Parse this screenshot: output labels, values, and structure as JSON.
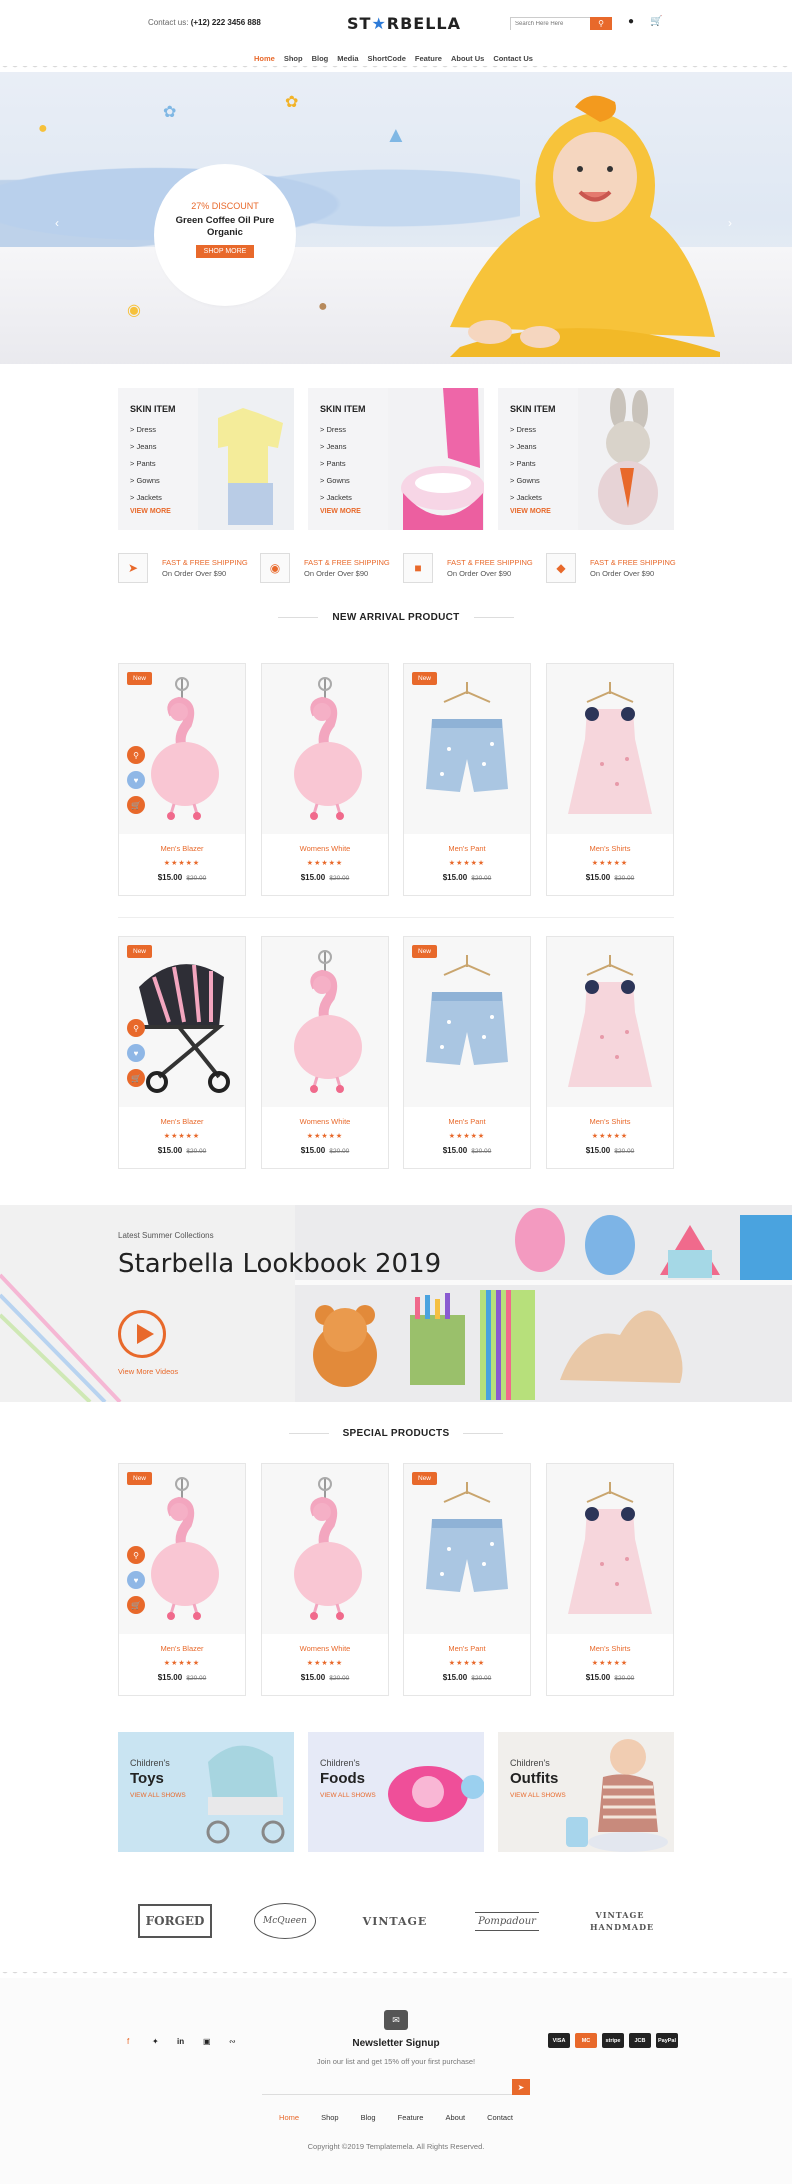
{
  "header": {
    "contact_label": "Contact us:",
    "contact_phone": "(+12) 222 3456 888",
    "logo_left": "ST",
    "logo_star": "★",
    "logo_right": "RBELLA",
    "search_placeholder": "Search Here Here",
    "nav": [
      "Home",
      "Shop",
      "Blog",
      "Media",
      "ShortCode",
      "Feature",
      "About Us",
      "Contact Us"
    ],
    "nav_active": "Home"
  },
  "hero": {
    "discount": "27% DISCOUNT",
    "title_line1": "Green Coffee Oil Pure",
    "title_line2": "Organic",
    "cta": "SHOP MORE"
  },
  "categories": [
    {
      "title": "SKIN ITEM",
      "items": [
        "> Dress",
        "> Jeans",
        "> Pants",
        "> Gowns",
        "> Jackets"
      ],
      "link": "VIEW MORE"
    },
    {
      "title": "SKIN ITEM",
      "items": [
        "> Dress",
        "> Jeans",
        "> Pants",
        "> Gowns",
        "> Jackets"
      ],
      "link": "VIEW MORE"
    },
    {
      "title": "SKIN ITEM",
      "items": [
        "> Dress",
        "> Jeans",
        "> Pants",
        "> Gowns",
        "> Jackets"
      ],
      "link": "VIEW MORE"
    }
  ],
  "shipping": [
    {
      "title": "FAST & FREE SHIPPING",
      "sub": "On Order Over $90"
    },
    {
      "title": "FAST & FREE SHIPPING",
      "sub": "On Order Over $90"
    },
    {
      "title": "FAST & FREE SHIPPING",
      "sub": "On Order Over $90"
    },
    {
      "title": "FAST & FREE SHIPPING",
      "sub": "On Order Over $90"
    }
  ],
  "new_arrival": {
    "heading": "NEW ARRIVAL PRODUCT",
    "row1": [
      {
        "badge": "New",
        "name": "Men's Blazer",
        "stars": "★★★★★",
        "price": "$15.00",
        "old": "$20.00",
        "img": "flamingo"
      },
      {
        "badge": "",
        "name": "Womens White",
        "stars": "★★★★★",
        "price": "$15.00",
        "old": "$20.00",
        "img": "flamingo"
      },
      {
        "badge": "New",
        "name": "Men's Pant",
        "stars": "★★★★★",
        "price": "$15.00",
        "old": "$20.00",
        "img": "shorts"
      },
      {
        "badge": "",
        "name": "Men's Shirts",
        "stars": "★★★★★",
        "price": "$15.00",
        "old": "$20.00",
        "img": "dress"
      }
    ],
    "row2": [
      {
        "badge": "New",
        "name": "Men's Blazer",
        "stars": "★★★★★",
        "price": "$15.00",
        "old": "$20.00",
        "img": "stroller"
      },
      {
        "badge": "",
        "name": "Womens White",
        "stars": "★★★★★",
        "price": "$15.00",
        "old": "$20.00",
        "img": "flamingo"
      },
      {
        "badge": "New",
        "name": "Men's Pant",
        "stars": "★★★★★",
        "price": "$15.00",
        "old": "$20.00",
        "img": "shorts"
      },
      {
        "badge": "",
        "name": "Men's Shirts",
        "stars": "★★★★★",
        "price": "$15.00",
        "old": "$20.00",
        "img": "dress"
      }
    ]
  },
  "lookbook": {
    "sub": "Latest Summer Collections",
    "title": "Starbella Lookbook 2019",
    "link": "View More Videos"
  },
  "special": {
    "heading": "SPECIAL PRODUCTS",
    "items": [
      {
        "badge": "New",
        "name": "Men's Blazer",
        "stars": "★★★★★",
        "price": "$15.00",
        "old": "$20.00",
        "img": "flamingo"
      },
      {
        "badge": "",
        "name": "Womens White",
        "stars": "★★★★★",
        "price": "$15.00",
        "old": "$20.00",
        "img": "flamingo"
      },
      {
        "badge": "New",
        "name": "Men's Pant",
        "stars": "★★★★★",
        "price": "$15.00",
        "old": "$20.00",
        "img": "shorts"
      },
      {
        "badge": "",
        "name": "Men's Shirts",
        "stars": "★★★★★",
        "price": "$15.00",
        "old": "$20.00",
        "img": "dress"
      }
    ]
  },
  "banners": [
    {
      "small": "Children's",
      "big": "Toys",
      "link": "VIEW ALL SHOWS"
    },
    {
      "small": "Children's",
      "big": "Foods",
      "link": "VIEW ALL SHOWS"
    },
    {
      "small": "Children's",
      "big": "Outfits",
      "link": "VIEW ALL SHOWS"
    }
  ],
  "brands": [
    "FORGED",
    "McQueen",
    "VINTAGE",
    "Pompadour",
    "VINTAGE HANDMADE"
  ],
  "footer": {
    "newsletter_title": "Newsletter Signup",
    "newsletter_sub": "Join our list and get 15% off your first purchase!",
    "nav": [
      "Home",
      "Shop",
      "Blog",
      "Feature",
      "About",
      "Contact"
    ],
    "nav_active": "Home",
    "copyright": "Copyright ©2019 Templatemela. All Rights Reserved.",
    "payments": [
      "VISA",
      "MC",
      "stripe",
      "JCB",
      "PayPal"
    ],
    "social_icons": [
      "facebook-icon",
      "twitter-icon",
      "linkedin-icon",
      "instagram-icon",
      "rss-icon"
    ]
  },
  "colors": {
    "accent": "#e8692b",
    "dark": "#222222",
    "star_blue": "#2d7bd8"
  }
}
